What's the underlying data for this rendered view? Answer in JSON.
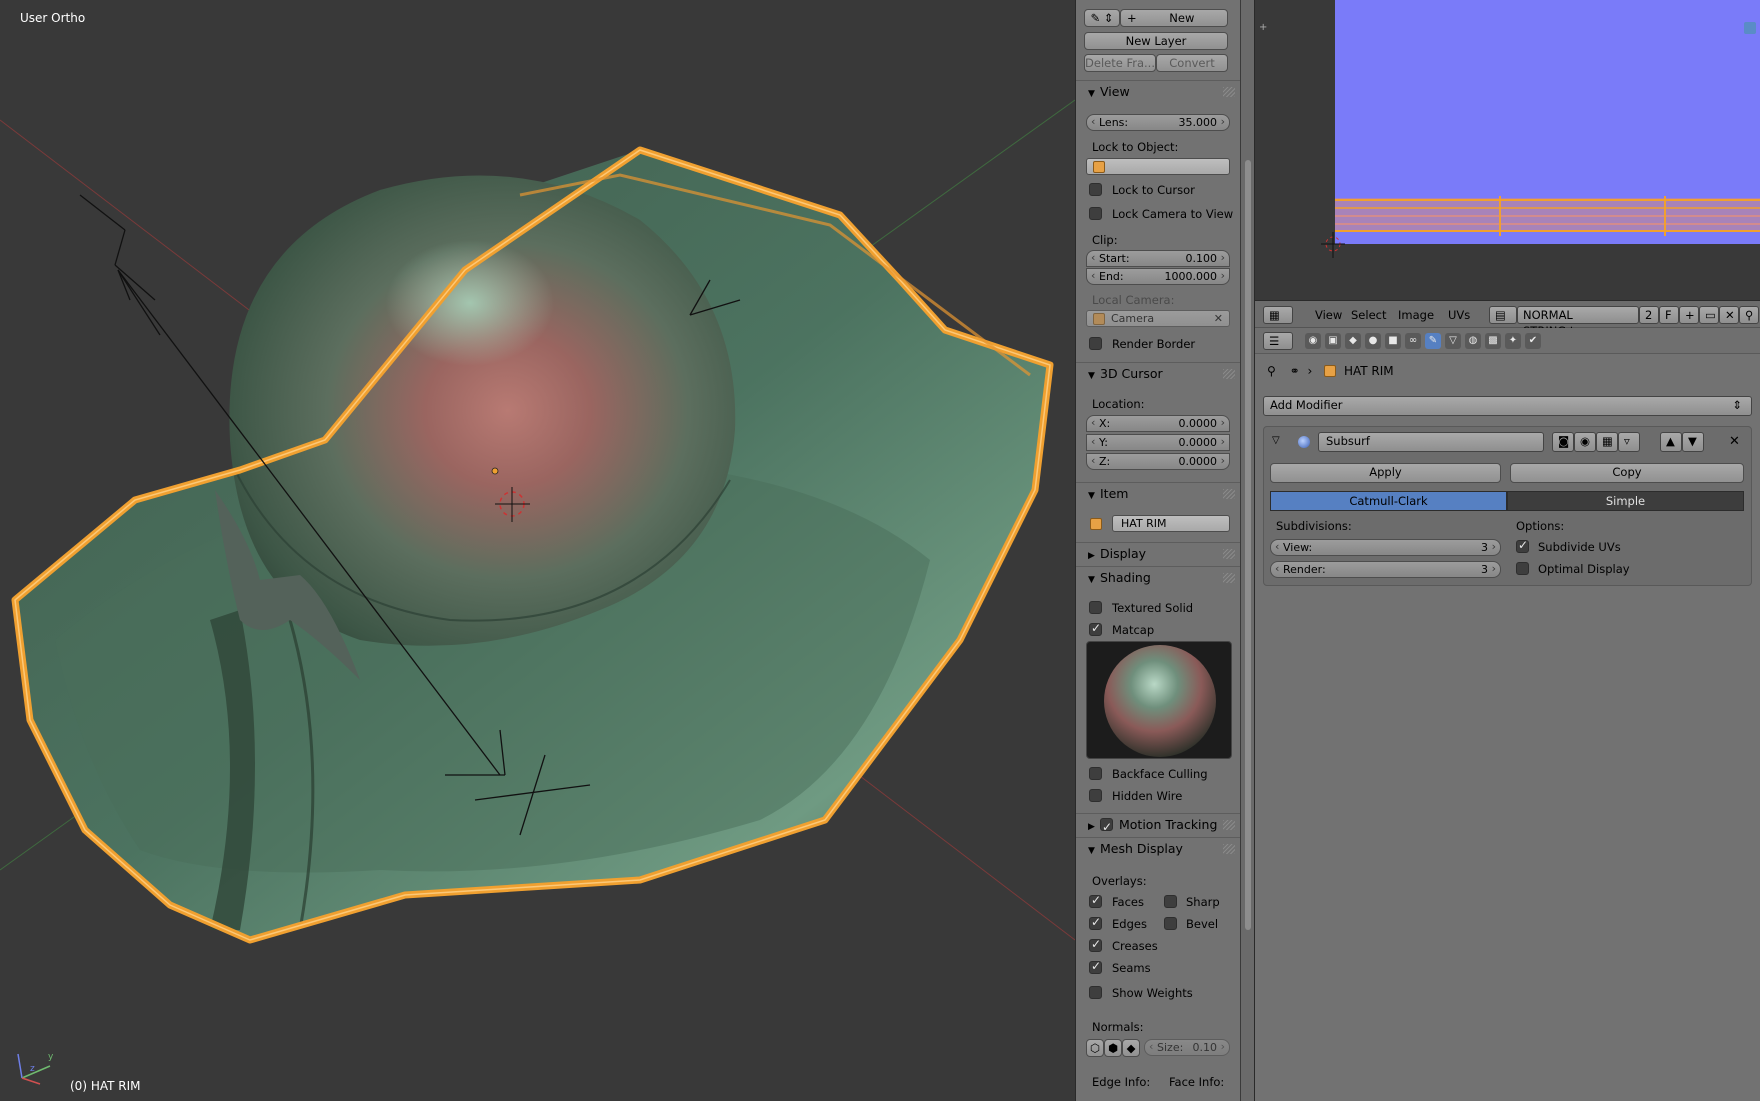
{
  "viewport": {
    "title": "User Ortho",
    "object_label": "(0) HAT RIM",
    "axis_y": "y",
    "axis_z": "z"
  },
  "npanel": {
    "grease": {
      "new": "New",
      "new_layer": "New Layer",
      "delete_frame": "Delete Fra...",
      "convert": "Convert"
    },
    "view": {
      "header": "View",
      "lens_label": "Lens:",
      "lens_value": "35.000",
      "lock_to_object": "Lock to Object:",
      "lock_to_cursor": "Lock to Cursor",
      "lock_camera": "Lock Camera to View",
      "clip": "Clip:",
      "start_label": "Start:",
      "start_value": "0.100",
      "end_label": "End:",
      "end_value": "1000.000",
      "local_camera": "Local Camera:",
      "camera": "Camera",
      "render_border": "Render Border"
    },
    "cursor": {
      "header": "3D Cursor",
      "location": "Location:",
      "x_label": "X:",
      "x_value": "0.0000",
      "y_label": "Y:",
      "y_value": "0.0000",
      "z_label": "Z:",
      "z_value": "0.0000"
    },
    "item": {
      "header": "Item",
      "name": "HAT RIM"
    },
    "display": {
      "header": "Display"
    },
    "shading": {
      "header": "Shading",
      "textured_solid": "Textured Solid",
      "matcap": "Matcap",
      "backface": "Backface Culling",
      "hidden_wire": "Hidden Wire"
    },
    "motion_tracking": {
      "header": "Motion Tracking"
    },
    "mesh_display": {
      "header": "Mesh Display",
      "overlays": "Overlays:",
      "faces": "Faces",
      "sharp": "Sharp",
      "edges": "Edges",
      "bevel": "Bevel",
      "creases": "Creases",
      "seams": "Seams",
      "show_weights": "Show Weights",
      "normals": "Normals:",
      "size_label": "Size:",
      "size_value": "0.10",
      "edge_info": "Edge Info:",
      "face_info": "Face Info:"
    }
  },
  "image_editor": {
    "menus": [
      "View",
      "Select",
      "Image",
      "UVs"
    ],
    "image_name": "NORMAL STRING.tga",
    "users": "2",
    "fake": "F"
  },
  "properties": {
    "object_name": "HAT RIM",
    "add_modifier": "Add Modifier",
    "modifier": {
      "name": "Subsurf",
      "apply": "Apply",
      "copy": "Copy",
      "catmull": "Catmull-Clark",
      "simple": "Simple",
      "subdivisions": "Subdivisions:",
      "view_label": "View:",
      "view_value": "3",
      "render_label": "Render:",
      "render_value": "3",
      "options": "Options:",
      "subdivide_uvs": "Subdivide UVs",
      "optimal_display": "Optimal Display"
    }
  },
  "colors": {
    "accent": "#5680c2",
    "selection": "#f0a030",
    "uv_image": "#7a7bf9"
  }
}
